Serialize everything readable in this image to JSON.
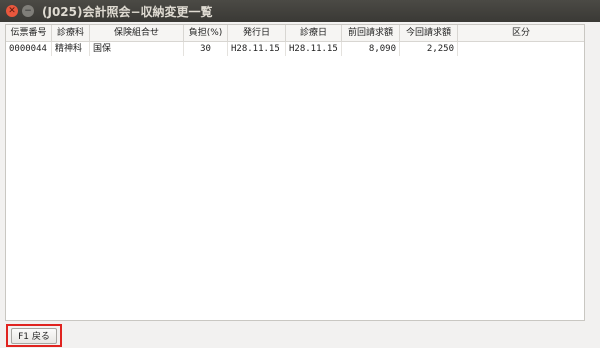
{
  "window": {
    "title": "(J025)会計照会−収納変更一覧"
  },
  "table": {
    "columns": [
      "伝票番号",
      "診療科",
      "保険組合せ",
      "負担(%)",
      "発行日",
      "診療日",
      "前回請求額",
      "今回請求額",
      "区分"
    ],
    "rows": [
      [
        "0000044",
        "精神科",
        "国保",
        "30",
        "H28.11.15",
        "H28.11.15",
        "8,090",
        "2,250",
        ""
      ]
    ]
  },
  "footer": {
    "back_button": "F1 戻る"
  }
}
